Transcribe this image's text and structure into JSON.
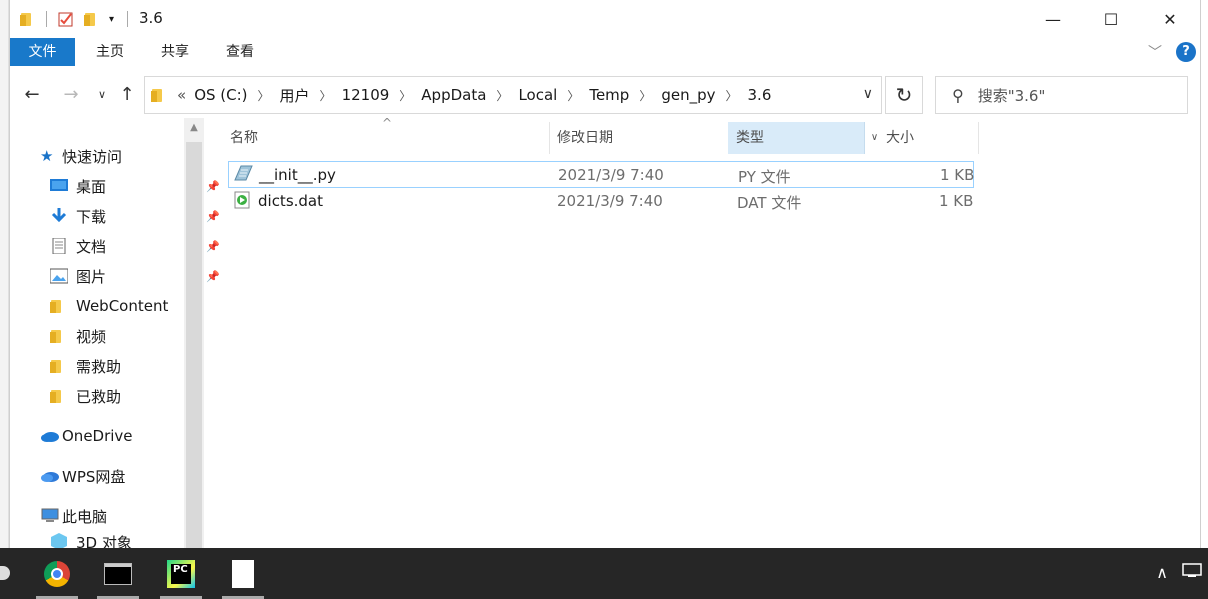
{
  "window": {
    "title": "3.6",
    "controls": {
      "minimize": "—",
      "maximize": "☐",
      "close": "✕"
    }
  },
  "ribbon": {
    "tabs": [
      "文件",
      "主页",
      "共享",
      "查看"
    ]
  },
  "address_bar": {
    "overflow": "«",
    "crumbs": [
      "OS (C:)",
      "用户",
      "12109",
      "AppData",
      "Local",
      "Temp",
      "gen_py",
      "3.6"
    ]
  },
  "search": {
    "placeholder": "搜索\"3.6\""
  },
  "nav_pane": {
    "quick_access": "快速访问",
    "pinned": [
      {
        "label": "桌面",
        "icon": "desktop-icon"
      },
      {
        "label": "下载",
        "icon": "download-icon"
      },
      {
        "label": "文档",
        "icon": "documents-icon"
      },
      {
        "label": "图片",
        "icon": "pictures-icon"
      }
    ],
    "folders": [
      "WebContent",
      "视频",
      "需救助",
      "已救助"
    ],
    "onedrive": "OneDrive",
    "wps": "WPS网盘",
    "this_pc": "此电脑",
    "objects_3d": "3D 对象"
  },
  "file_list": {
    "columns": {
      "name": "名称",
      "modified": "修改日期",
      "type": "类型",
      "size": "大小"
    },
    "rows": [
      {
        "name": "__init__.py",
        "modified": "2021/3/9 7:40",
        "type": "PY 文件",
        "size": "1 KB",
        "selected": true,
        "icon": "python-file-icon"
      },
      {
        "name": "dicts.dat",
        "modified": "2021/3/9 7:40",
        "type": "DAT 文件",
        "size": "1 KB",
        "selected": false,
        "icon": "dat-file-icon"
      }
    ]
  },
  "taskbar": {
    "apps": [
      "chrome-icon",
      "terminal-icon",
      "pycharm-icon",
      "document-icon"
    ],
    "pycharm_label": "PC"
  },
  "colors": {
    "accent": "#1979ca",
    "selection_border": "#99d1ff",
    "header_highlight": "#d9ebf9",
    "taskbar": "#262626"
  }
}
